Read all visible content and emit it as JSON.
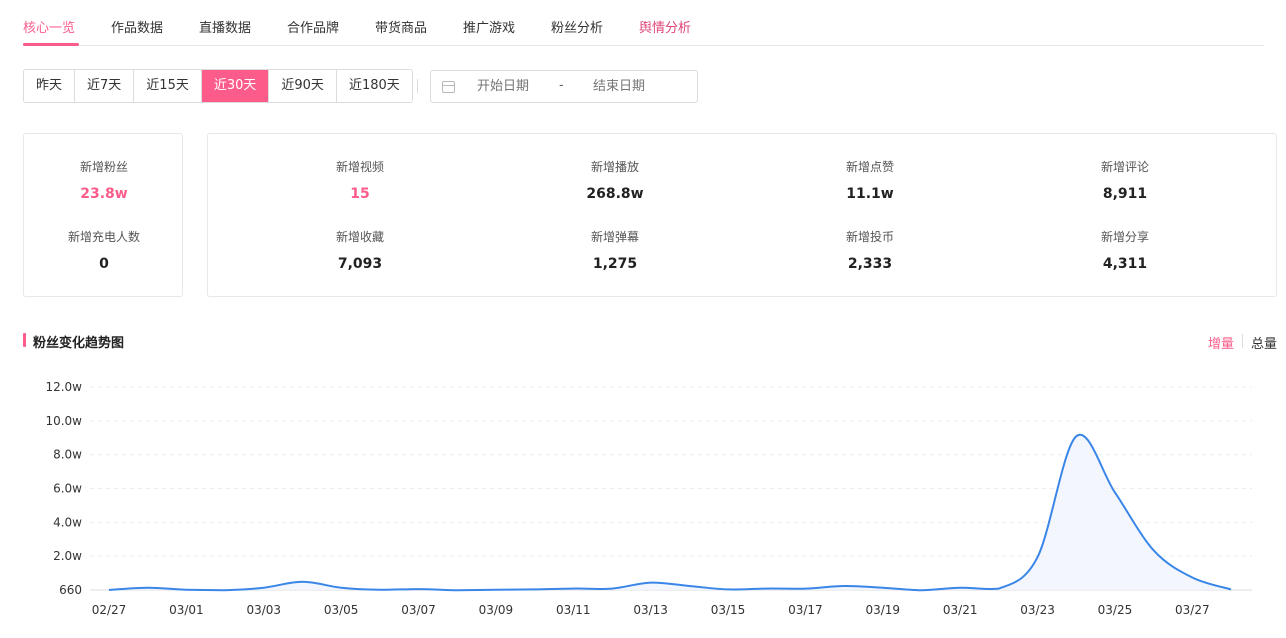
{
  "tabs": [
    {
      "label": "核心一览",
      "active": true
    },
    {
      "label": "作品数据"
    },
    {
      "label": "直播数据"
    },
    {
      "label": "合作品牌"
    },
    {
      "label": "带货商品"
    },
    {
      "label": "推广游戏"
    },
    {
      "label": "粉丝分析"
    },
    {
      "label": "舆情分析"
    }
  ],
  "ranges": [
    "昨天",
    "近7天",
    "近15天",
    "近30天",
    "近90天",
    "近180天"
  ],
  "active_range": "近30天",
  "date_range": {
    "start_placeholder": "开始日期",
    "separator": "-",
    "end_placeholder": "结束日期"
  },
  "stats_left": [
    {
      "label": "新增粉丝",
      "value": "23.8w",
      "highlight": true
    },
    {
      "label": "新增充电人数",
      "value": "0"
    }
  ],
  "stats_right": [
    {
      "label": "新增视频",
      "value": "15",
      "highlight": true
    },
    {
      "label": "新增播放",
      "value": "268.8w"
    },
    {
      "label": "新增点赞",
      "value": "11.1w"
    },
    {
      "label": "新增评论",
      "value": "8,911"
    },
    {
      "label": "新增收藏",
      "value": "7,093"
    },
    {
      "label": "新增弹幕",
      "value": "1,275"
    },
    {
      "label": "新增投币",
      "value": "2,333"
    },
    {
      "label": "新增分享",
      "value": "4,311"
    }
  ],
  "section": {
    "title": "粉丝变化趋势图",
    "toggle_increment": "增量",
    "toggle_total": "总量"
  },
  "colors": {
    "accent": "#fb5c8a",
    "line": "#3a86e8"
  },
  "chart_data": {
    "type": "area",
    "y_tick_labels": [
      "660",
      "2.0w",
      "4.0w",
      "6.0w",
      "8.0w",
      "10.0w",
      "12.0w"
    ],
    "ylim": [
      660,
      120000
    ],
    "x_tick_labels": [
      "02/27",
      "03/01",
      "03/03",
      "03/05",
      "03/07",
      "03/09",
      "03/11",
      "03/13",
      "03/15",
      "03/17",
      "03/19",
      "03/21",
      "03/23",
      "03/25",
      "03/27"
    ],
    "x": [
      "02/27",
      "02/28",
      "03/01",
      "03/02",
      "03/03",
      "03/04",
      "03/05",
      "03/06",
      "03/07",
      "03/08",
      "03/09",
      "03/10",
      "03/11",
      "03/12",
      "03/13",
      "03/14",
      "03/15",
      "03/16",
      "03/17",
      "03/18",
      "03/19",
      "03/20",
      "03/21",
      "03/22",
      "03/23",
      "03/24",
      "03/25",
      "03/26",
      "03/27",
      "03/28"
    ],
    "series": [
      {
        "values": [
          700,
          2000,
          800,
          500,
          2000,
          5500,
          2000,
          800,
          1200,
          500,
          800,
          1000,
          1500,
          1500,
          5000,
          3000,
          1000,
          1500,
          1500,
          3000,
          2000,
          500,
          2000,
          1500,
          20000,
          91000,
          58000,
          24000,
          8000,
          1000
        ]
      }
    ],
    "grid": true
  }
}
